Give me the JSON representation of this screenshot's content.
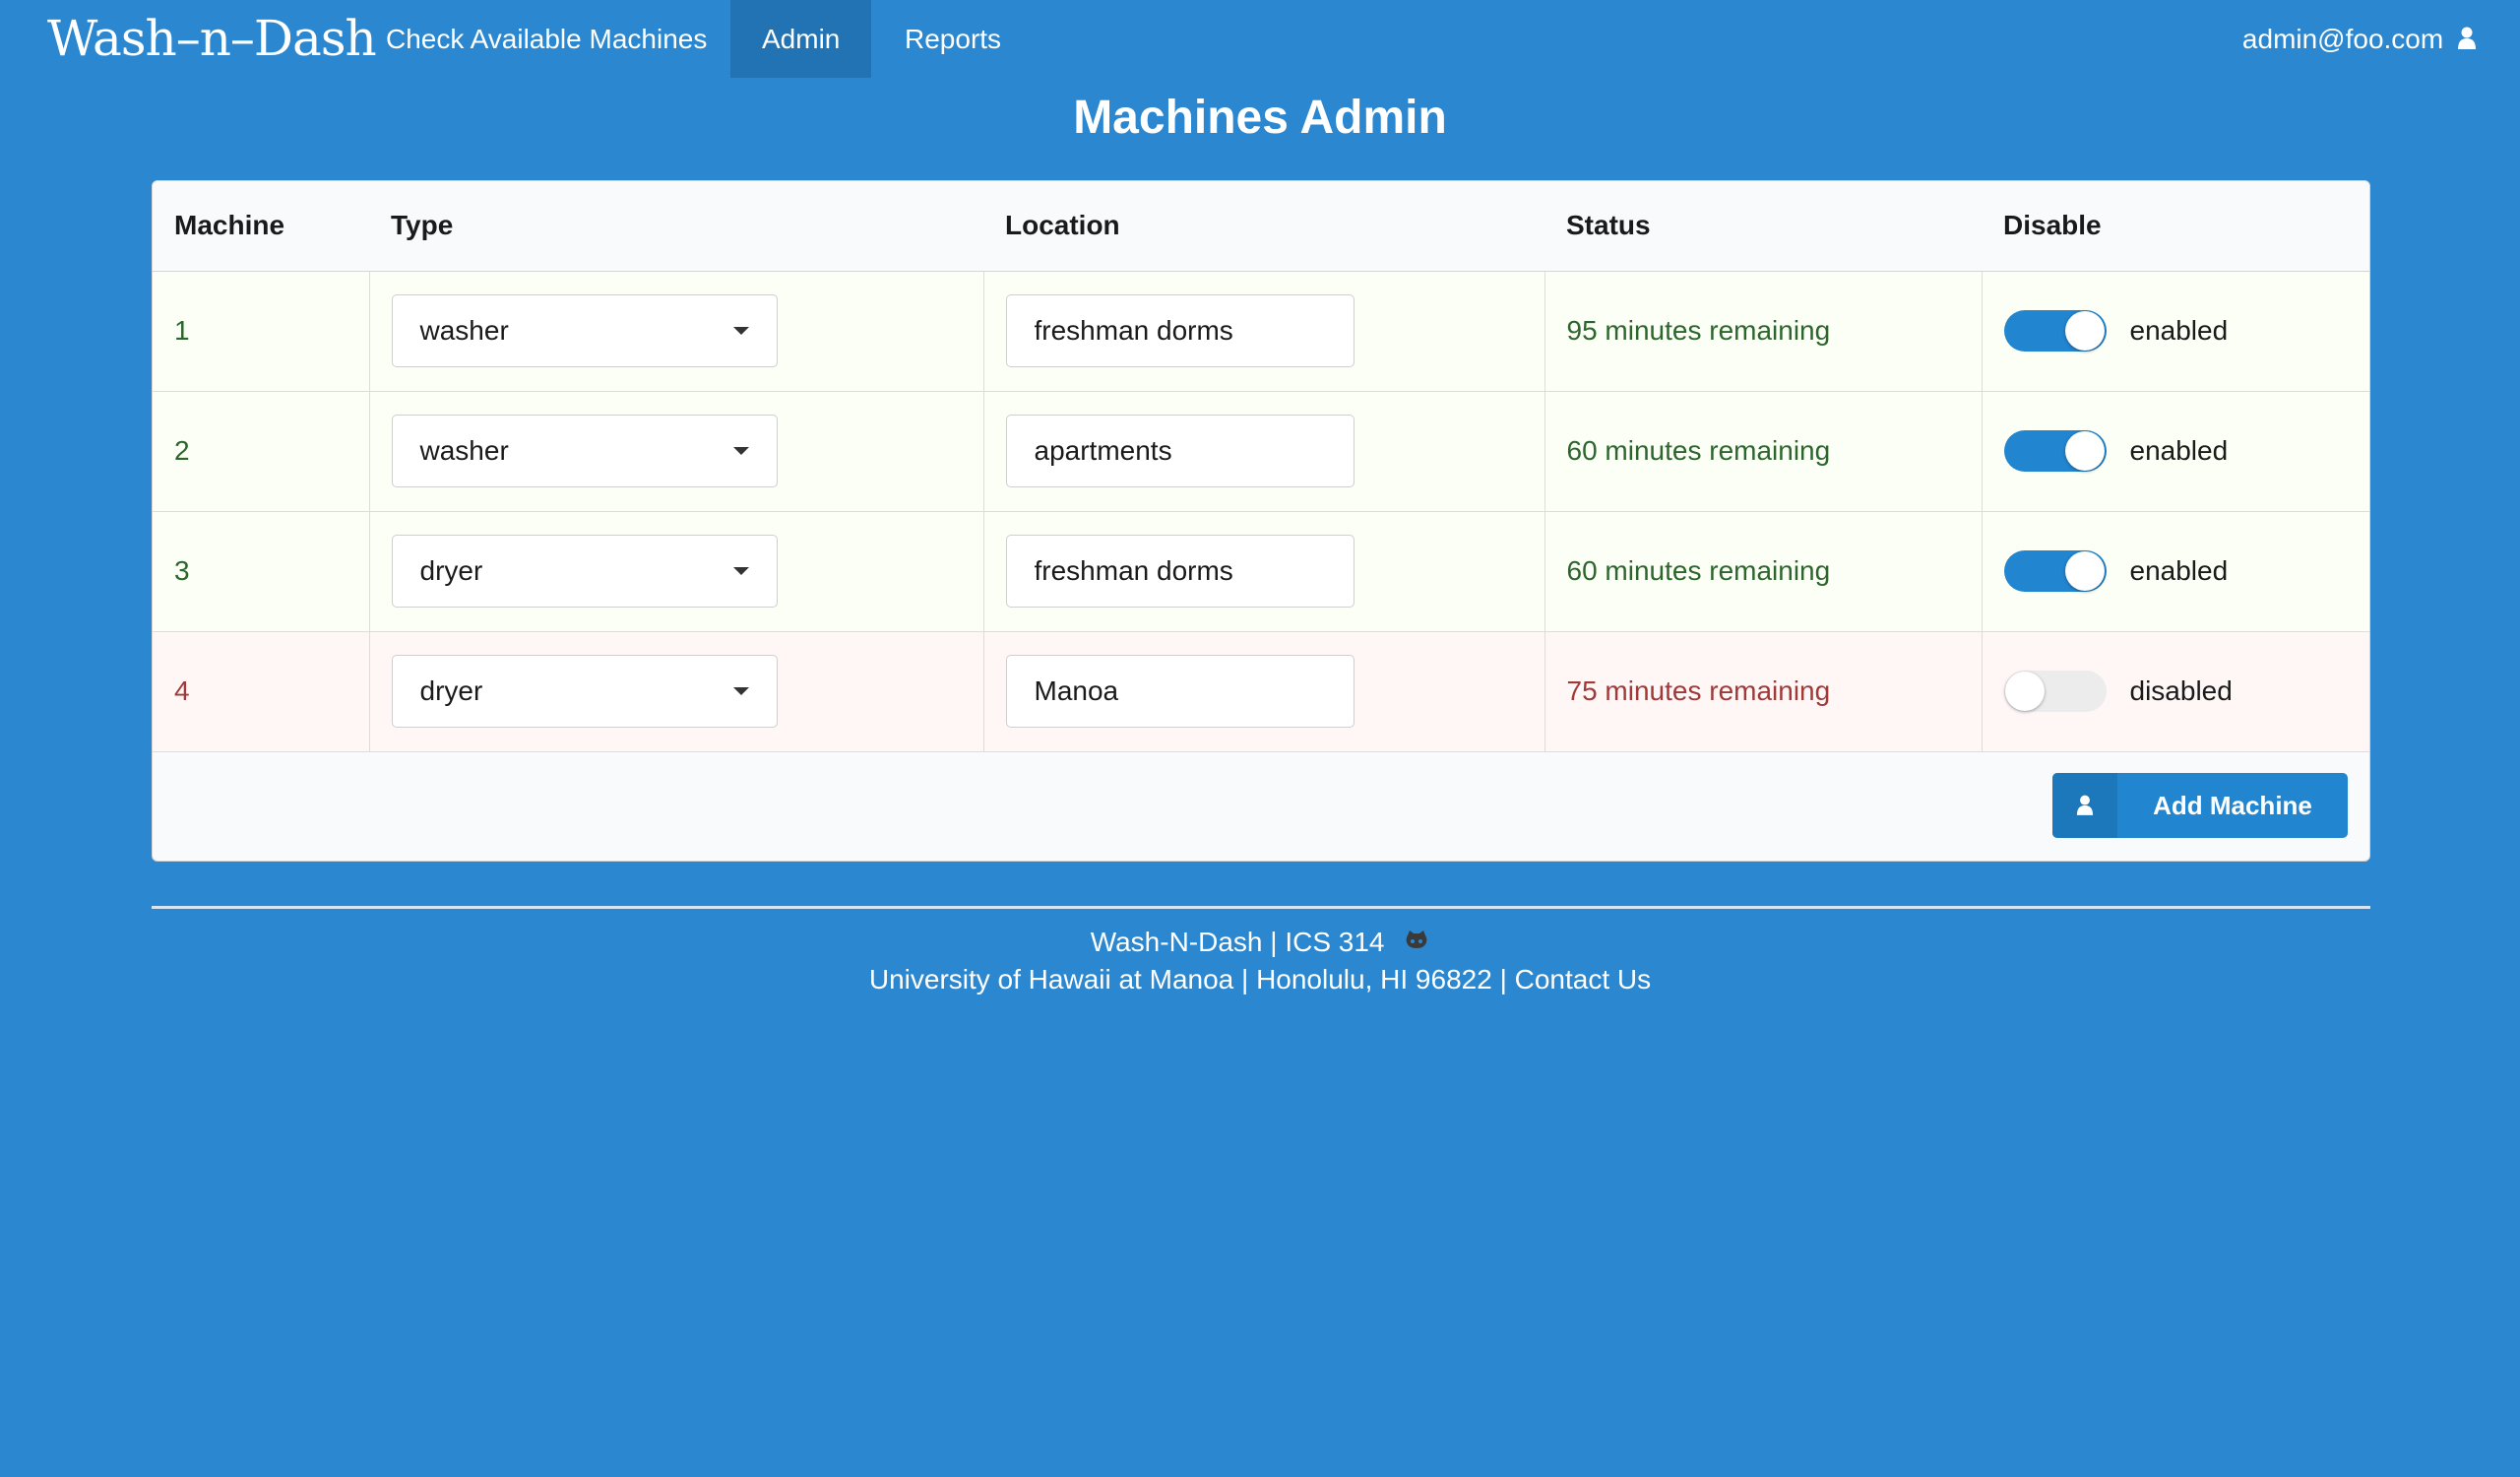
{
  "nav": {
    "logo": "Wash–n–Dash",
    "items": [
      {
        "label": "Check Available Machines",
        "active": false
      },
      {
        "label": "Admin",
        "active": true
      },
      {
        "label": "Reports",
        "active": false
      }
    ],
    "user": "admin@foo.com",
    "user_icon": "user-icon"
  },
  "page": {
    "title": "Machines Admin"
  },
  "table": {
    "headers": [
      "Machine",
      "Type",
      "Location",
      "Status",
      "Disable"
    ],
    "rows": [
      {
        "machine": "1",
        "type": "washer",
        "location": "freshman dorms",
        "status": "95 minutes remaining",
        "toggle_label": "enabled",
        "enabled": true
      },
      {
        "machine": "2",
        "type": "washer",
        "location": "apartments",
        "status": "60 minutes remaining",
        "toggle_label": "enabled",
        "enabled": true
      },
      {
        "machine": "3",
        "type": "dryer",
        "location": "freshman dorms",
        "status": "60 minutes remaining",
        "toggle_label": "enabled",
        "enabled": true
      },
      {
        "machine": "4",
        "type": "dryer",
        "location": "Manoa",
        "status": "75 minutes remaining",
        "toggle_label": "disabled",
        "enabled": false
      }
    ],
    "add_button": {
      "label": "Add Machine",
      "icon": "user-icon"
    }
  },
  "footer": {
    "line1": "Wash-N-Dash | ICS 314",
    "line1_icon": "github-icon",
    "line2_text": "University of Hawaii at Manoa | Honolulu, HI 96822 | ",
    "line2_link": "Contact Us"
  },
  "colors": {
    "background": "#2a87d0",
    "nav_active": "#2173b4",
    "primary": "#2185d0",
    "positive_text": "#2c662d",
    "positive_bg": "#fcfff5",
    "negative_text": "#9f3a38",
    "negative_bg": "#fff6f6"
  }
}
